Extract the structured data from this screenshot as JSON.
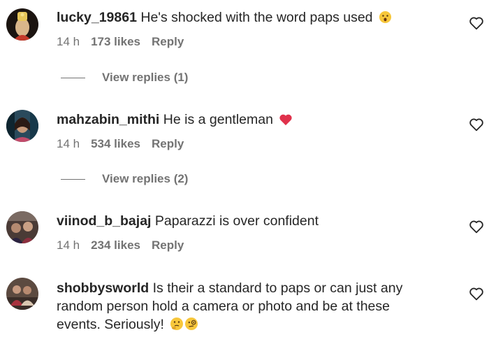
{
  "comments": [
    {
      "username": "lucky_19861",
      "text": "He's shocked with the word paps used",
      "emoji": "hushed-face",
      "time": "14 h",
      "likes": "173 likes",
      "reply": "Reply",
      "view_replies": "View replies (1)"
    },
    {
      "username": "mahzabin_mithi",
      "text": "He is a gentleman",
      "emoji": "red-heart",
      "time": "14 h",
      "likes": "534 likes",
      "reply": "Reply",
      "view_replies": "View replies (2)"
    },
    {
      "username": "viinod_b_bajaj",
      "text": "Paparazzi is over confident",
      "time": "14 h",
      "likes": "234 likes",
      "reply": "Reply"
    },
    {
      "username": "shobbysworld",
      "text": "Is their a standard to paps or can just any random person hold a camera or photo and be at these events. Seriously!",
      "emoji": "thinking-face-and-monocle-face"
    }
  ],
  "colors": {
    "text": "#262626",
    "secondary": "#737373",
    "heart": "#e0314b"
  }
}
